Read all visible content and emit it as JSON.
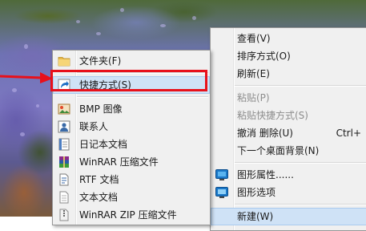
{
  "context_menu": {
    "items": [
      {
        "label": "查看(V)",
        "icon": "",
        "disabled": false
      },
      {
        "label": "排序方式(O)",
        "icon": "",
        "disabled": false
      },
      {
        "label": "刷新(E)",
        "icon": "",
        "disabled": false
      },
      {
        "label": "粘贴(P)",
        "icon": "",
        "disabled": true
      },
      {
        "label": "粘贴快捷方式(S)",
        "icon": "",
        "disabled": true
      },
      {
        "label": "撤消 删除(U)",
        "shortcut": "Ctrl+",
        "icon": "",
        "disabled": false
      },
      {
        "label": "下一个桌面背景(N)",
        "icon": "",
        "disabled": false
      },
      {
        "label": "图形属性......",
        "icon": "graphics-properties-icon",
        "disabled": false
      },
      {
        "label": "图形选项",
        "icon": "graphics-options-icon",
        "disabled": false
      },
      {
        "label": "新建(W)",
        "icon": "",
        "disabled": false,
        "highlighted": true
      }
    ]
  },
  "new_submenu": {
    "items": [
      {
        "label": "文件夹(F)",
        "icon": "folder-icon"
      },
      {
        "label": "快捷方式(S)",
        "icon": "shortcut-icon",
        "highlighted": true
      },
      {
        "label": "BMP 图像",
        "icon": "bmp-image-icon"
      },
      {
        "label": "联系人",
        "icon": "contact-icon"
      },
      {
        "label": "日记本文档",
        "icon": "journal-document-icon"
      },
      {
        "label": "WinRAR 压缩文件",
        "icon": "winrar-archive-icon"
      },
      {
        "label": "RTF 文档",
        "icon": "rtf-document-icon"
      },
      {
        "label": "文本文档",
        "icon": "text-document-icon"
      },
      {
        "label": "WinRAR ZIP 压缩文件",
        "icon": "winrar-zip-icon"
      }
    ]
  },
  "annotation": {
    "color": "#e8101a",
    "highlighted_item": "快捷方式(S)"
  }
}
